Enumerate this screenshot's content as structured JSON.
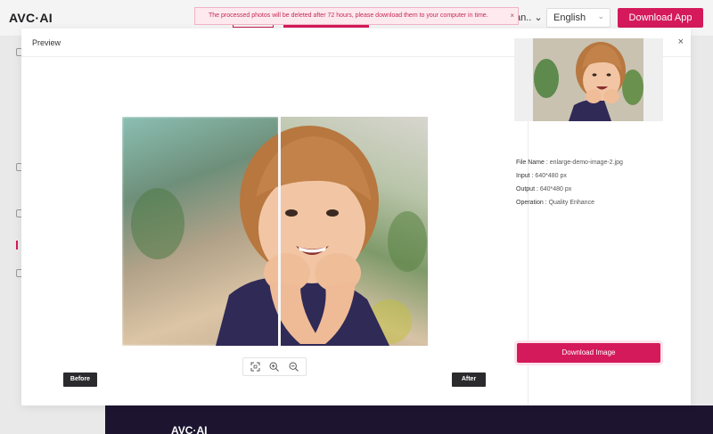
{
  "app": {
    "logo": "AVC·AI",
    "footer_logo": "AVC·AI"
  },
  "header": {
    "lang_truncated": "an..",
    "language": "English",
    "download_app": "Download App"
  },
  "toast": {
    "message": "The processed photos will be deleted after 72 hours, please download them to your computer in time.",
    "close": "×"
  },
  "modal": {
    "title": "Preview",
    "close": "×",
    "before_label": "Before",
    "after_label": "After",
    "zoom_icons": [
      "fit-screen-icon",
      "zoom-in-icon",
      "zoom-out-icon"
    ]
  },
  "details": {
    "file_name_label": "File Name :",
    "file_name": "enlarge-demo-image-2.jpg",
    "input_label": "Input :",
    "input": "640*480 px",
    "output_label": "Output :",
    "output": "640*480 px",
    "operation_label": "Operation :",
    "operation": "Quality Enhance"
  },
  "actions": {
    "download_image": "Download Image"
  },
  "colors": {
    "accent": "#d41a5a",
    "footer": "#1d1530",
    "toast_bg": "#fde9ee"
  }
}
